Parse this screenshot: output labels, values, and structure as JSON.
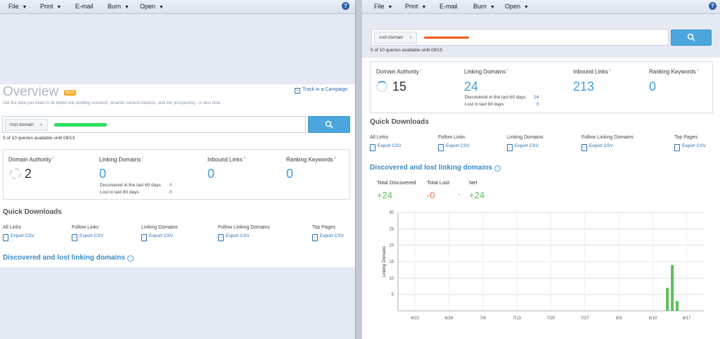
{
  "menu": {
    "file": "File",
    "print": "Print",
    "email": "E-mail",
    "burn": "Burn",
    "open": "Open",
    "help": "?"
  },
  "colors": {
    "accent": "#4aa6dd",
    "positive": "#5cbf5c",
    "negative": "#e8735a",
    "redaction_green": "#2ee060",
    "redaction_orange": "#f05a1a"
  },
  "left": {
    "title": "Overview",
    "beta": "BETA",
    "track_campaign": "Track in a Campaign",
    "subtitle": "Get the data you need to do better link building research, smarter content ideation, and link prospecting - in less time.",
    "scope": "root domain",
    "quota": "9 of 10 queries available until 09/13",
    "metrics": {
      "domain_authority_label": "Domain Authority",
      "domain_authority_value": "2",
      "linking_domains_label": "Linking Domains",
      "linking_domains_value": "0",
      "discovered_label": "Discovered in the last 60 days",
      "discovered_value": "0",
      "lost_label": "Lost in last 60 days",
      "lost_value": "0",
      "inbound_links_label": "Inbound Links",
      "inbound_links_value": "0",
      "ranking_keywords_label": "Ranking Keywords",
      "ranking_keywords_value": "0",
      "info_mark": "i"
    },
    "quick_downloads": "Quick Downloads",
    "downloads": [
      {
        "label": "All Links",
        "export": "Export CSV"
      },
      {
        "label": "Follow Links",
        "export": "Export CSV"
      },
      {
        "label": "Linking Domains",
        "export": "Export CSV"
      },
      {
        "label": "Follow Linking Domains",
        "export": "Export CSV"
      },
      {
        "label": "Top Pages",
        "export": "Export CSV"
      }
    ],
    "discovered_lost": "Discovered and lost linking domains"
  },
  "right": {
    "scope": "root domain",
    "quota": "5 of 10 queries available until 09/15",
    "metrics": {
      "domain_authority_label": "Domain Authority",
      "domain_authority_value": "15",
      "linking_domains_label": "Linking Domains",
      "linking_domains_value": "24",
      "discovered_label": "Discovered in the last 60 days",
      "discovered_value": "24",
      "lost_label": "Lost in last 60 days",
      "lost_value": "0",
      "inbound_links_label": "Inbound Links",
      "inbound_links_value": "213",
      "ranking_keywords_label": "Ranking Keywords",
      "ranking_keywords_value": "0",
      "info_mark": "i"
    },
    "quick_downloads": "Quick Downloads",
    "downloads": [
      {
        "label": "All Links",
        "export": "Export CSV"
      },
      {
        "label": "Follow Links",
        "export": "Export CSV"
      },
      {
        "label": "Linking Domains",
        "export": "Export CSV"
      },
      {
        "label": "Follow Linking Domains",
        "export": "Export CSV"
      },
      {
        "label": "Top Pages",
        "export": "Export CSV"
      }
    ],
    "discovered_lost": "Discovered and lost linking domains",
    "stats": {
      "total_discovered_label": "Total Discovered",
      "total_discovered_value": "+24",
      "total_lost_label": "Total Lost",
      "total_lost_value": "-0",
      "separator": "-",
      "net_label": "Net",
      "net_value": "+24"
    }
  },
  "chart_data": {
    "type": "bar",
    "title": "",
    "xlabel": "",
    "ylabel": "Linking Domains",
    "x_ticks": [
      "6/22",
      "6/29",
      "7/6",
      "7/13",
      "7/20",
      "7/27",
      "8/3",
      "8/10",
      "8/17"
    ],
    "y_ticks": [
      5,
      10,
      15,
      20,
      25,
      30
    ],
    "ylim": [
      0,
      30
    ],
    "grid": true,
    "series": [
      {
        "values": [
          {
            "date": "8/13",
            "value": 7
          },
          {
            "date": "8/14",
            "value": 14
          },
          {
            "date": "8/15",
            "value": 3
          }
        ]
      }
    ]
  }
}
